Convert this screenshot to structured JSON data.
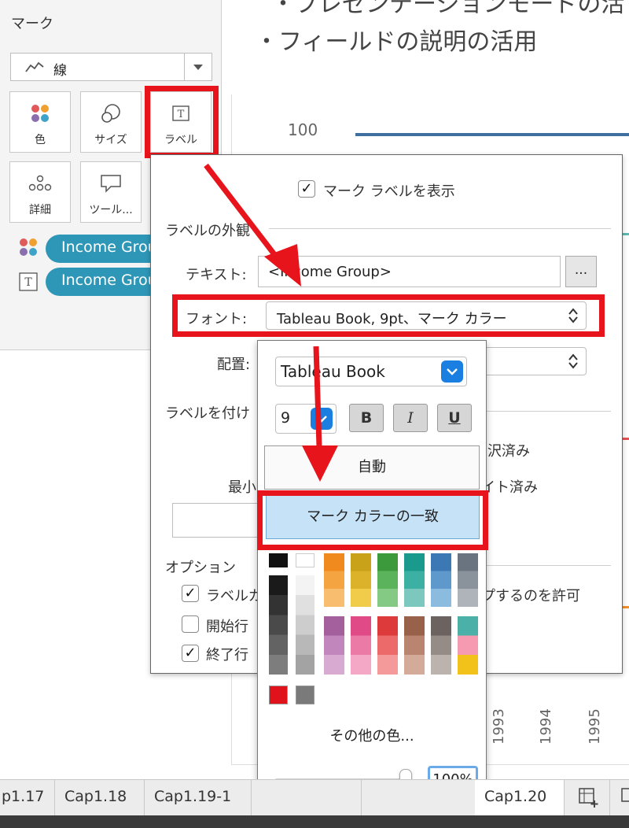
{
  "marks": {
    "title": "マーク",
    "mark_type": "線",
    "buttons": [
      "色",
      "サイズ",
      "ラベル",
      "詳細",
      "ツール..."
    ],
    "pills": [
      "Income Group",
      "Income Group"
    ]
  },
  "slide": {
    "bullet_top": "・プレゼンテーションモードの活",
    "bullet": "・フィールドの説明の活用",
    "y_tick": "100",
    "x_ticks": [
      "1993",
      "1994",
      "1995"
    ]
  },
  "dialog": {
    "show_labels": "マーク ラベルを表示",
    "appearance_section": "ラベルの外観",
    "text_label": "テキスト:",
    "text_value": "<Income Group>",
    "ellipsis": "...",
    "font_label": "フォント:",
    "font_value": "Tableau Book, 9pt、マーク カラー",
    "align_label": "配置:",
    "labeling_section": "ラベルを付け",
    "selected_fragment": "沢済み",
    "highlighted_fragment": "イト済み",
    "min_label": "最小",
    "options_section": "オプション",
    "option1": "ラベルカ",
    "option1_tail": "プするのを許可",
    "option2": "開始行",
    "option3": "終了行"
  },
  "font_popup": {
    "font_name": "Tableau Book",
    "font_size": "9",
    "bold": "B",
    "italic": "I",
    "underline": "U",
    "auto": "自動",
    "match_mark_color": "マーク カラーの一致",
    "more_colors": "その他の色...",
    "opacity": "100%"
  },
  "tabs": [
    "p1.17",
    "Cap1.18",
    "Cap1.19-1",
    "Cap1.20"
  ],
  "colors": {
    "accent_red": "#e8141b",
    "pill_teal": "#2e97b7",
    "selection_blue": "#c5e2f7"
  }
}
